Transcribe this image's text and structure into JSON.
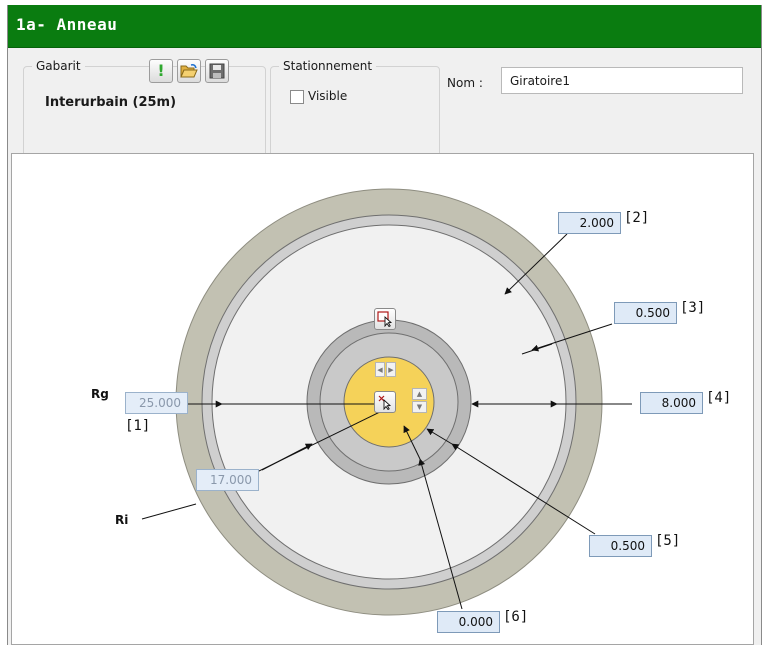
{
  "window": {
    "title": "1a- Anneau"
  },
  "gabarit": {
    "legend": "Gabarit",
    "value": "Interurbain (25m)",
    "buttons": [
      "warning-icon",
      "open-folder-icon",
      "save-icon"
    ]
  },
  "stationnement": {
    "legend": "Stationnement",
    "visible_label": "Visible",
    "visible_checked": false
  },
  "nom": {
    "label": "Nom :",
    "value": "Giratoire1"
  },
  "diagram": {
    "labels": {
      "rg": "Rg",
      "ri": "Ri"
    },
    "values": {
      "rg": {
        "value": "25.000",
        "ref": "[1]"
      },
      "ri": {
        "value": "17.000"
      },
      "v2": {
        "value": "2.000",
        "ref": "[2]"
      },
      "v3": {
        "value": "0.500",
        "ref": "[3]"
      },
      "v4": {
        "value": "8.000",
        "ref": "[4]"
      },
      "v5": {
        "value": "0.500",
        "ref": "[5]"
      },
      "v6": {
        "value": "0.000",
        "ref": "[6]"
      }
    },
    "colors": {
      "outer_ring": "#c2c1b2",
      "carriageway": "#f1f1f1",
      "edge_band": "#cfcfcf",
      "island_ring": "#b9b9b9",
      "center": "#f5d259"
    }
  }
}
